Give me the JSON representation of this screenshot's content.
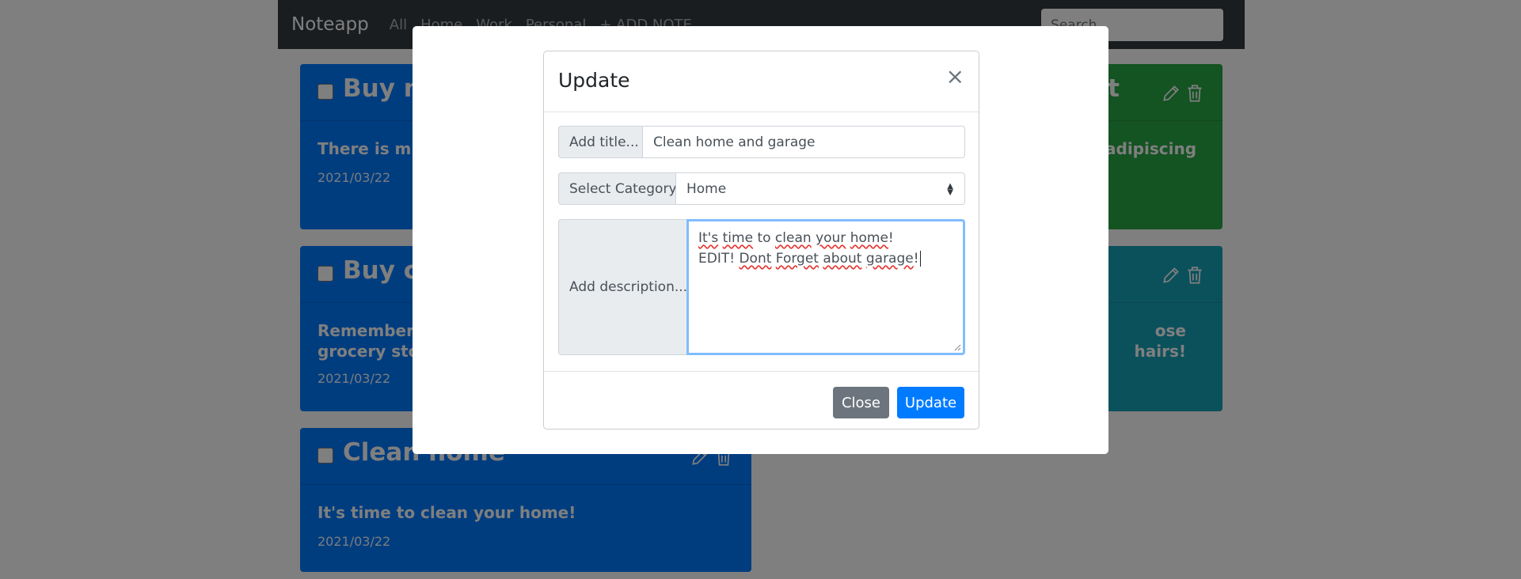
{
  "navbar": {
    "brand": "Noteapp",
    "links": [
      "All",
      "Home",
      "Work",
      "Personal",
      "+ ADD NOTE"
    ],
    "search_placeholder": "Search"
  },
  "notes": [
    {
      "title": "Buy m",
      "text": "There is mill",
      "date": "2021/03/22",
      "color": "#007bff"
    },
    {
      "title": "Buy ch",
      "text": "Remember t\ngrocery stor",
      "date": "2021/03/22",
      "color": "#007bff"
    },
    {
      "title": "Clean home",
      "text": "It's time to clean your home!",
      "date": "2021/03/22",
      "color": "#007bff"
    },
    {
      "title": "t",
      "text": "adipiscing",
      "color": "#28a745"
    },
    {
      "title": "",
      "text": "ose hairs!",
      "color": "#17a2b8"
    }
  ],
  "modal": {
    "title": "Update",
    "close_glyph": "×",
    "title_label": "Add title...",
    "title_value": "Clean home and garage",
    "category_label": "Select Category",
    "category_value": "Home",
    "description_label": "Add description...",
    "description_line1_parts": [
      "It's",
      " ",
      "time",
      " to ",
      "clean",
      " ",
      "your",
      " ",
      "home",
      "!"
    ],
    "description_line2_parts": [
      "EDIT! ",
      "Dont",
      " ",
      "Forget",
      " ",
      "about",
      " ",
      "garage",
      "!"
    ],
    "close_button": "Close",
    "update_button": "Update"
  },
  "icons": {
    "edit": "pencil-icon",
    "delete": "trash-icon"
  },
  "colors": {
    "primary": "#007bff",
    "secondary": "#6c757d",
    "navbar": "#343a40",
    "focus": "#80bdff"
  }
}
